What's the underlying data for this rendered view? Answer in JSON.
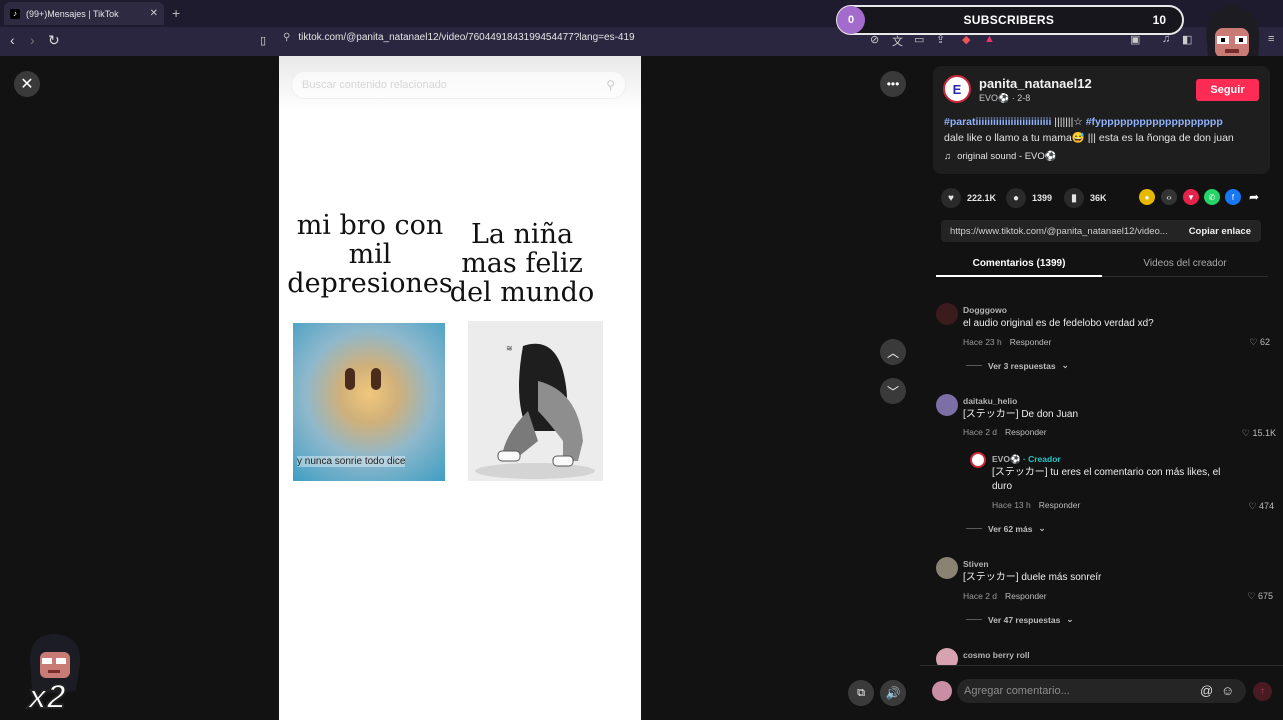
{
  "browser": {
    "tab_title": "(99+)Mensajes | TikTok",
    "tab_close": "✕",
    "new_tab": "+",
    "url": "tiktok.com/@panita_natanael12/video/7604491843199454477?lang=es-419"
  },
  "overlay": {
    "subscribers_label": "SUBSCRIBERS",
    "subscribers_start": "0",
    "subscribers_goal": "10",
    "multiplier": "x2"
  },
  "video": {
    "search_placeholder": "Buscar contenido relacionado",
    "meme_left": "mi bro con mil depresiones",
    "meme_right": "La niña mas feliz del mundo",
    "left_image_caption": "y nunca sonrie todo dice"
  },
  "post": {
    "author": "panita_natanael12",
    "author_sub": "EVO⚽ · 2-8",
    "follow_label": "Seguir",
    "desc_tag1": "#paratiiiiiiiiiiiiiiiiiiiiiiiiii",
    "desc_mid": " |||||||☆ ",
    "desc_tag2": "#fyppppppppppppppppppp",
    "desc_line2": "dale like o llamo a tu mama😅 ||| esta es la ñonga de don juan",
    "sound": "original sound - EVO⚽",
    "likes": "222.1K",
    "comments": "1399",
    "saves": "36K",
    "link": "https://www.tiktok.com/@panita_natanael12/video...",
    "copy_label": "Copiar enlace",
    "tab_comments": "Comentarios (1399)",
    "tab_creator": "Videos del creador"
  },
  "comments": [
    {
      "user": "Dogggowo",
      "text": "el audio original es de fedelobo verdad xd?",
      "time": "Hace 23 h",
      "reply": "Responder",
      "likes": "62",
      "more": "Ver 3 respuestas"
    },
    {
      "user": "daitaku_helio",
      "text": "[ステッカー] De don Juan",
      "time": "Hace 2 d",
      "reply": "Responder",
      "likes": "15.1K",
      "more": "Ver 62 más"
    },
    {
      "user": "Stiven",
      "text": "[ステッカー] duele más sonreír",
      "time": "Hace 2 d",
      "reply": "Responder",
      "likes": "675",
      "more": "Ver 47 respuestas"
    },
    {
      "user": "cosmo berry roll"
    }
  ],
  "creator_reply": {
    "user": "EVO⚽",
    "creator_tag": "· Creador",
    "text": "[ステッカー] tu eres el comentario con más likes, el duro",
    "time": "Hace 13 h",
    "reply": "Responder",
    "likes": "474"
  },
  "add_comment_placeholder": "Agregar comentario..."
}
